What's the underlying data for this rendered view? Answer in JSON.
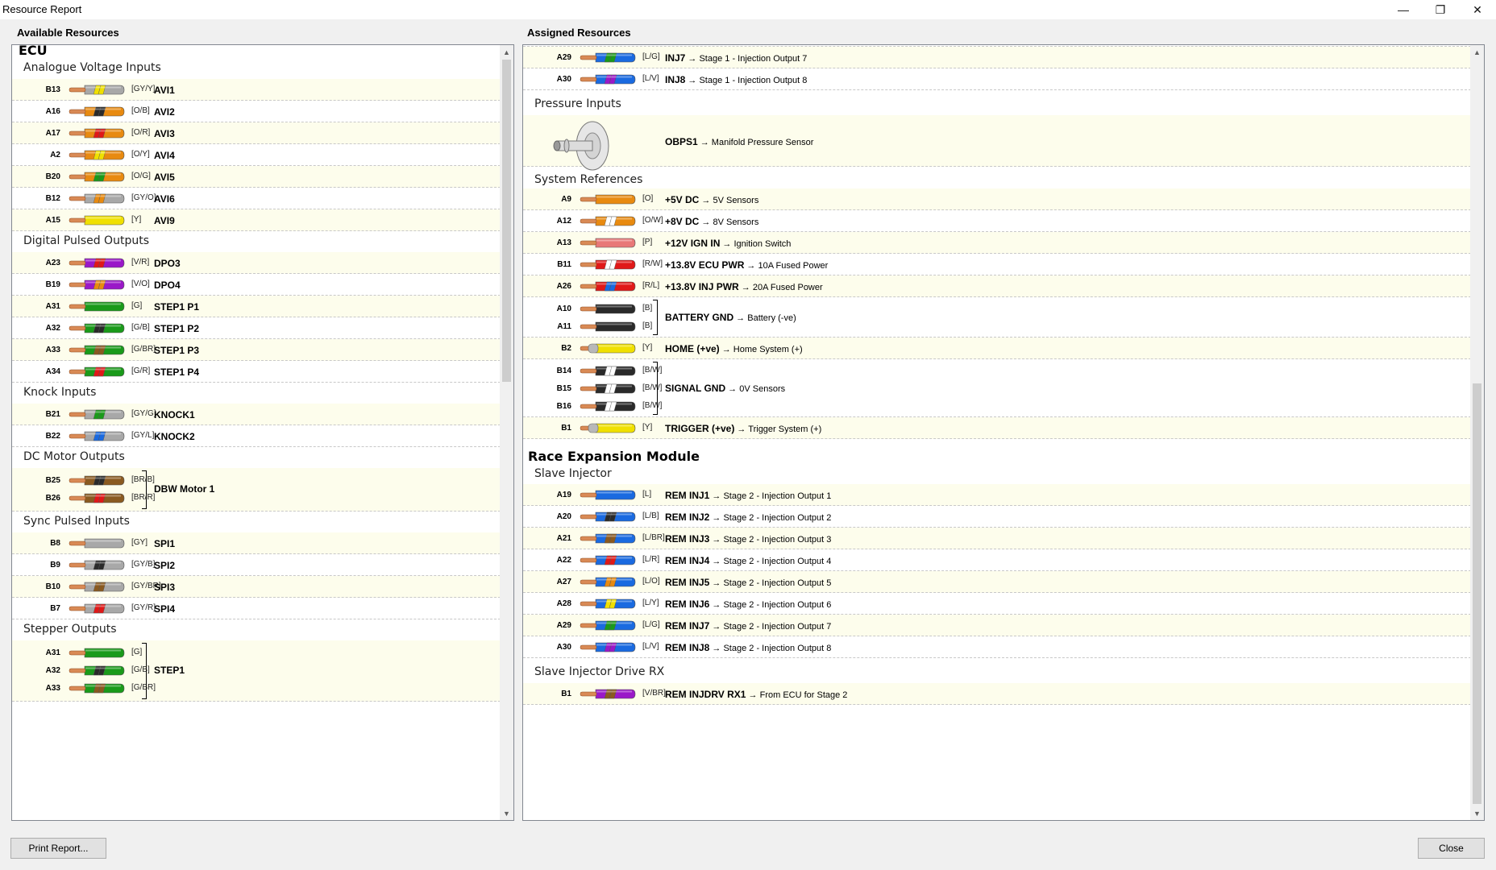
{
  "window": {
    "title": "Resource Report",
    "minimize_icon": "minimize-icon",
    "restore_icon": "restore-icon",
    "close_icon": "close-icon"
  },
  "left_title": "Available Resources",
  "right_title": "Assigned Resources",
  "buttons": {
    "print": "Print Report...",
    "close": "Close"
  },
  "wire_colors": {
    "GY": "#a8a8a8",
    "Y": "#f0e000",
    "O": "#e88a10",
    "B": "#2a2a2a",
    "R": "#e01818",
    "G": "#1a9a1a",
    "V": "#9a18c8",
    "BR": "#8a5a20",
    "L": "#1a6ae0",
    "W": "#ffffff",
    "P": "#e87878"
  },
  "left": {
    "module": "ECU",
    "groups": [
      {
        "name": "Analogue Voltage Inputs",
        "items": [
          {
            "pin": "B13",
            "code": "[GY/Y]",
            "base": "GY",
            "stripe": "Y",
            "signal": "AVI1"
          },
          {
            "pin": "A16",
            "code": "[O/B]",
            "base": "O",
            "stripe": "B",
            "signal": "AVI2"
          },
          {
            "pin": "A17",
            "code": "[O/R]",
            "base": "O",
            "stripe": "R",
            "signal": "AVI3"
          },
          {
            "pin": "A2",
            "code": "[O/Y]",
            "base": "O",
            "stripe": "Y",
            "signal": "AVI4"
          },
          {
            "pin": "B20",
            "code": "[O/G]",
            "base": "O",
            "stripe": "G",
            "signal": "AVI5"
          },
          {
            "pin": "B12",
            "code": "[GY/O]",
            "base": "GY",
            "stripe": "O",
            "signal": "AVI6"
          },
          {
            "pin": "A15",
            "code": "[Y]",
            "base": "Y",
            "stripe": "",
            "signal": "AVI9"
          }
        ]
      },
      {
        "name": "Digital Pulsed Outputs",
        "items": [
          {
            "pin": "A23",
            "code": "[V/R]",
            "base": "V",
            "stripe": "R",
            "signal": "DPO3"
          },
          {
            "pin": "B19",
            "code": "[V/O]",
            "base": "V",
            "stripe": "O",
            "signal": "DPO4"
          },
          {
            "pin": "A31",
            "code": "[G]",
            "base": "G",
            "stripe": "",
            "signal": "STEP1 P1"
          },
          {
            "pin": "A32",
            "code": "[G/B]",
            "base": "G",
            "stripe": "B",
            "signal": "STEP1 P2"
          },
          {
            "pin": "A33",
            "code": "[G/BR]",
            "base": "G",
            "stripe": "BR",
            "signal": "STEP1 P3"
          },
          {
            "pin": "A34",
            "code": "[G/R]",
            "base": "G",
            "stripe": "R",
            "signal": "STEP1 P4"
          }
        ]
      },
      {
        "name": "Knock Inputs",
        "items": [
          {
            "pin": "B21",
            "code": "[GY/G]",
            "base": "GY",
            "stripe": "G",
            "signal": "KNOCK1"
          },
          {
            "pin": "B22",
            "code": "[GY/L]",
            "base": "GY",
            "stripe": "L",
            "signal": "KNOCK2"
          }
        ]
      },
      {
        "name": "DC Motor Outputs",
        "grouped": true,
        "signal": "DBW Motor 1",
        "items": [
          {
            "pin": "B25",
            "code": "[BR/B]",
            "base": "BR",
            "stripe": "B"
          },
          {
            "pin": "B26",
            "code": "[BR/R]",
            "base": "BR",
            "stripe": "R"
          }
        ]
      },
      {
        "name": "Sync Pulsed Inputs",
        "items": [
          {
            "pin": "B8",
            "code": "[GY]",
            "base": "GY",
            "stripe": "",
            "signal": "SPI1"
          },
          {
            "pin": "B9",
            "code": "[GY/B]",
            "base": "GY",
            "stripe": "B",
            "signal": "SPI2"
          },
          {
            "pin": "B10",
            "code": "[GY/BR]",
            "base": "GY",
            "stripe": "BR",
            "signal": "SPI3"
          },
          {
            "pin": "B7",
            "code": "[GY/R]",
            "base": "GY",
            "stripe": "R",
            "signal": "SPI4"
          }
        ]
      },
      {
        "name": "Stepper Outputs",
        "grouped": true,
        "signal": "STEP1",
        "items": [
          {
            "pin": "A31",
            "code": "[G]",
            "base": "G",
            "stripe": ""
          },
          {
            "pin": "A32",
            "code": "[G/B]",
            "base": "G",
            "stripe": "B"
          },
          {
            "pin": "A33",
            "code": "[G/BR]",
            "base": "G",
            "stripe": "BR"
          }
        ]
      }
    ]
  },
  "right": {
    "top_rows": [
      {
        "pin": "A29",
        "code": "[L/G]",
        "base": "L",
        "stripe": "G",
        "signal": "INJ7",
        "dest": "→ Stage 1 - Injection Output 7"
      },
      {
        "pin": "A30",
        "code": "[L/V]",
        "base": "L",
        "stripe": "V",
        "signal": "INJ8",
        "dest": "→ Stage 1 - Injection Output 8"
      }
    ],
    "pressure": {
      "name": "Pressure Inputs",
      "signal": "OBPS1",
      "dest": "→ Manifold Pressure Sensor",
      "icon": "pressure-sensor-icon"
    },
    "sysref": {
      "name": "System References",
      "rows": [
        {
          "items": [
            {
              "pin": "A9",
              "code": "[O]",
              "base": "O",
              "stripe": ""
            }
          ],
          "signal": "+5V DC",
          "dest": "→ 5V Sensors"
        },
        {
          "items": [
            {
              "pin": "A12",
              "code": "[O/W]",
              "base": "O",
              "stripe": "W"
            }
          ],
          "signal": "+8V DC",
          "dest": "→ 8V Sensors"
        },
        {
          "items": [
            {
              "pin": "A13",
              "code": "[P]",
              "base": "P",
              "stripe": ""
            }
          ],
          "signal": "+12V IGN IN",
          "dest": "→ Ignition Switch"
        },
        {
          "items": [
            {
              "pin": "B11",
              "code": "[R/W]",
              "base": "R",
              "stripe": "W"
            }
          ],
          "signal": "+13.8V ECU PWR",
          "dest": "→ 10A Fused Power"
        },
        {
          "items": [
            {
              "pin": "A26",
              "code": "[R/L]",
              "base": "R",
              "stripe": "L"
            }
          ],
          "signal": "+13.8V INJ PWR",
          "dest": "→ 20A Fused Power"
        },
        {
          "items": [
            {
              "pin": "A10",
              "code": "[B]",
              "base": "B",
              "stripe": ""
            },
            {
              "pin": "A11",
              "code": "[B]",
              "base": "B",
              "stripe": ""
            }
          ],
          "signal": "BATTERY GND",
          "dest": "→ Battery (-ve)"
        },
        {
          "items": [
            {
              "pin": "B2",
              "code": "[Y]",
              "base": "Y",
              "stripe": "",
              "shield": true
            }
          ],
          "signal": "HOME (+ve)",
          "dest": "→ Home System (+)"
        },
        {
          "items": [
            {
              "pin": "B14",
              "code": "[B/W]",
              "base": "B",
              "stripe": "W"
            },
            {
              "pin": "B15",
              "code": "[B/W]",
              "base": "B",
              "stripe": "W"
            },
            {
              "pin": "B16",
              "code": "[B/W]",
              "base": "B",
              "stripe": "W"
            }
          ],
          "signal": "SIGNAL GND",
          "dest": "→ 0V Sensors"
        },
        {
          "items": [
            {
              "pin": "B1",
              "code": "[Y]",
              "base": "Y",
              "stripe": "",
              "shield": true
            }
          ],
          "signal": "TRIGGER (+ve)",
          "dest": "→ Trigger System (+)"
        }
      ]
    },
    "module2": "Race Expansion Module",
    "slave": {
      "name": "Slave Injector",
      "rows": [
        {
          "pin": "A19",
          "code": "[L]",
          "base": "L",
          "stripe": "",
          "signal": "REM INJ1",
          "dest": "→ Stage 2 - Injection Output 1"
        },
        {
          "pin": "A20",
          "code": "[L/B]",
          "base": "L",
          "stripe": "B",
          "signal": "REM INJ2",
          "dest": "→ Stage 2 - Injection Output 2"
        },
        {
          "pin": "A21",
          "code": "[L/BR]",
          "base": "L",
          "stripe": "BR",
          "signal": "REM INJ3",
          "dest": "→ Stage 2 - Injection Output 3"
        },
        {
          "pin": "A22",
          "code": "[L/R]",
          "base": "L",
          "stripe": "R",
          "signal": "REM INJ4",
          "dest": "→ Stage 2 - Injection Output 4"
        },
        {
          "pin": "A27",
          "code": "[L/O]",
          "base": "L",
          "stripe": "O",
          "signal": "REM INJ5",
          "dest": "→ Stage 2 - Injection Output 5"
        },
        {
          "pin": "A28",
          "code": "[L/Y]",
          "base": "L",
          "stripe": "Y",
          "signal": "REM INJ6",
          "dest": "→ Stage 2 - Injection Output 6"
        },
        {
          "pin": "A29",
          "code": "[L/G]",
          "base": "L",
          "stripe": "G",
          "signal": "REM INJ7",
          "dest": "→ Stage 2 - Injection Output 7"
        },
        {
          "pin": "A30",
          "code": "[L/V]",
          "base": "L",
          "stripe": "V",
          "signal": "REM INJ8",
          "dest": "→ Stage 2 - Injection Output 8"
        }
      ]
    },
    "drive": {
      "name": "Slave Injector Drive RX",
      "rows": [
        {
          "pin": "B1",
          "code": "[V/BR]",
          "base": "V",
          "stripe": "BR",
          "signal": "REM INJDRV RX1",
          "dest": "→ From ECU for Stage 2"
        }
      ]
    }
  }
}
